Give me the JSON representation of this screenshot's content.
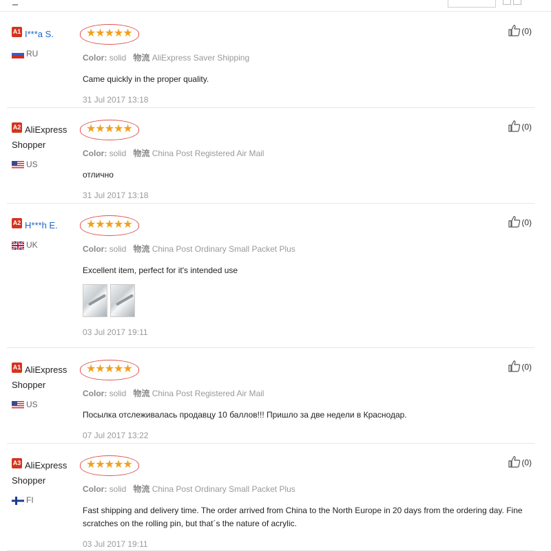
{
  "labels": {
    "color": "Color:"
  },
  "reviews": [
    {
      "badge": "A1",
      "name": "I***a S.",
      "name2": "",
      "name_style": "link",
      "country": "RU",
      "flag": "ru",
      "stars": "★★★★★",
      "color_value": "solid",
      "logistics_cn": "物流",
      "shipping": "AliExpress Saver Shipping",
      "text": "Came quickly in the proper quality.",
      "date": "31 Jul 2017 13:18",
      "likes": "(0)",
      "photos": 0
    },
    {
      "badge": "A2",
      "name": "AliExpress",
      "name2": "Shopper",
      "name_style": "plain",
      "country": "US",
      "flag": "us",
      "stars": "★★★★★",
      "color_value": "solid",
      "logistics_cn": "物流",
      "shipping": "China Post Registered Air Mail",
      "text": "отлично",
      "date": "31 Jul 2017 13:18",
      "likes": "(0)",
      "photos": 0
    },
    {
      "badge": "A2",
      "name": "H***h E.",
      "name2": "",
      "name_style": "link",
      "country": "UK",
      "flag": "uk",
      "stars": "★★★★★",
      "color_value": "solid",
      "logistics_cn": "物流",
      "shipping": "China Post Ordinary Small Packet Plus",
      "text": "Excellent item, perfect for it's intended use",
      "date": "03 Jul 2017 19:11",
      "likes": "(0)",
      "photos": 2
    },
    {
      "badge": "A1",
      "name": "AliExpress",
      "name2": "Shopper",
      "name_style": "plain",
      "country": "US",
      "flag": "us",
      "stars": "★★★★★",
      "color_value": "solid",
      "logistics_cn": "物流",
      "shipping": "China Post Registered Air Mail",
      "text": "Посылка отслеживалась продавцу 10 баллов!!! Пришло за две недели в Краснодар.",
      "date": "07 Jul 2017 13:22",
      "likes": "(0)",
      "photos": 0
    },
    {
      "badge": "A3",
      "name": "AliExpress",
      "name2": "Shopper",
      "name_style": "plain",
      "country": "FI",
      "flag": "fi",
      "stars": "★★★★★",
      "color_value": "solid",
      "logistics_cn": "物流",
      "shipping": "China Post Ordinary Small Packet Plus",
      "text": "Fast shipping and delivery time. The order arrived from China to the North Europe in 20 days from the ordering day. Fine scratches on the rolling pin, but that´s the nature of acrylic.",
      "date": "03 Jul 2017 19:11",
      "likes": "(0)",
      "photos": 0
    }
  ]
}
